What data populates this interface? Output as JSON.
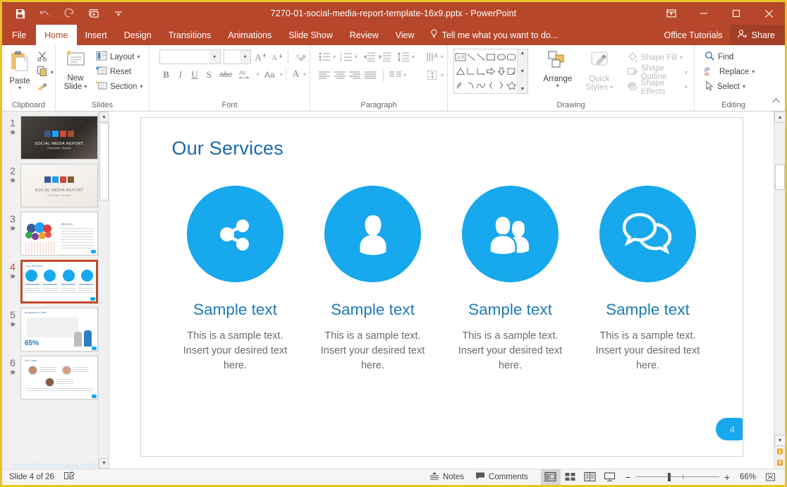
{
  "window": {
    "title": "7270-01-social-media-report-template-16x9.pptx - PowerPoint",
    "quick_access": [
      {
        "name": "save-icon",
        "label": "Save"
      },
      {
        "name": "undo-icon",
        "label": "Undo"
      },
      {
        "name": "redo-icon",
        "label": "Redo"
      },
      {
        "name": "start-presentation-icon",
        "label": "Start From Beginning"
      },
      {
        "name": "customize-qat-icon",
        "label": "Customize Quick Access Toolbar"
      }
    ],
    "controls": {
      "ribbon_display": "Ribbon Display Options",
      "minimize": "Minimize",
      "restore": "Restore Down",
      "close": "Close"
    }
  },
  "tabs": {
    "items": [
      {
        "label": "File",
        "active": false
      },
      {
        "label": "Home",
        "active": true
      },
      {
        "label": "Insert",
        "active": false
      },
      {
        "label": "Design",
        "active": false
      },
      {
        "label": "Transitions",
        "active": false
      },
      {
        "label": "Animations",
        "active": false
      },
      {
        "label": "Slide Show",
        "active": false
      },
      {
        "label": "Review",
        "active": false
      },
      {
        "label": "View",
        "active": false
      }
    ],
    "tell_me": "Tell me what you want to do...",
    "office_tutorials": "Office Tutorials",
    "share": "Share"
  },
  "ribbon": {
    "clipboard": {
      "label": "Clipboard",
      "paste": "Paste",
      "cut": "Cut",
      "copy": "Copy",
      "format_painter": "Format Painter"
    },
    "slides": {
      "label": "Slides",
      "new_slide_line1": "New",
      "new_slide_line2": "Slide",
      "layout": "Layout",
      "reset": "Reset",
      "section": "Section"
    },
    "font": {
      "label": "Font",
      "font_name_value": "",
      "font_size_value": "",
      "grow_font": "Increase Font Size",
      "shrink_font": "Decrease Font Size",
      "clear_formatting": "Clear All Formatting",
      "bold": "B",
      "italic": "I",
      "underline": "U",
      "shadow": "S",
      "strikethrough": "abc",
      "character_spacing": "AV",
      "change_case": "Aa",
      "font_color": "A"
    },
    "paragraph": {
      "label": "Paragraph",
      "bullets": "Bullets",
      "numbering": "Numbering",
      "decrease_indent": "Decrease List Level",
      "increase_indent": "Increase List Level",
      "line_spacing": "Line Spacing",
      "text_direction": "Text Direction",
      "align_text": "Align Text",
      "convert_smartart": "Convert to SmartArt",
      "align_left": "Align Left",
      "align_center": "Center",
      "align_right": "Align Right",
      "justify": "Justify",
      "columns": "Columns"
    },
    "drawing": {
      "label": "Drawing",
      "arrange": "Arrange",
      "quick_styles_line1": "Quick",
      "quick_styles_line2": "Styles",
      "shape_fill": "Shape Fill",
      "shape_outline": "Shape Outline",
      "shape_effects": "Shape Effects"
    },
    "editing": {
      "label": "Editing",
      "find": "Find",
      "replace": "Replace",
      "select": "Select"
    },
    "collapse_ribbon": "Collapse the Ribbon"
  },
  "thumbnails": [
    {
      "number": "1",
      "starred": true,
      "selected": false,
      "kind": "cover-dark"
    },
    {
      "number": "2",
      "starred": true,
      "selected": false,
      "kind": "cover-light"
    },
    {
      "number": "3",
      "starred": true,
      "selected": false,
      "kind": "about-us"
    },
    {
      "number": "4",
      "starred": true,
      "selected": true,
      "kind": "our-services"
    },
    {
      "number": "5",
      "starred": true,
      "selected": false,
      "kind": "infographic-65"
    },
    {
      "number": "6",
      "starred": true,
      "selected": false,
      "kind": "our-team"
    }
  ],
  "thumbnail_text": {
    "slide1_title": "SOCIAL MEDIA REPORT",
    "slide1_sub": "Presentation Template",
    "slide2_title": "SOCIAL MEDIA REPORT",
    "slide2_sub": "Presentation Template",
    "slide3_title": "About Us",
    "slide4_title": "Our Services",
    "slide5_title": "Infographic Chart",
    "slide5_stat": "65%",
    "slide6_title": "Our Team",
    "watermark": "www.freetemplates-college.com"
  },
  "slide": {
    "title": "Our Services",
    "page_badge": "4",
    "services": [
      {
        "icon": "share-icon",
        "heading": "Sample text",
        "body": "This is a sample text. Insert your desired text here."
      },
      {
        "icon": "user-icon",
        "heading": "Sample text",
        "body": "This is a sample text. Insert your desired text here."
      },
      {
        "icon": "users-group-icon",
        "heading": "Sample text",
        "body": "This is a sample text. Insert your desired text here."
      },
      {
        "icon": "chat-bubbles-icon",
        "heading": "Sample text",
        "body": "This is a sample text. Insert your desired text here."
      }
    ]
  },
  "status": {
    "slide_counter": "Slide 4 of 26",
    "accessibility": "Accessibility Checker",
    "notes": "Notes",
    "comments": "Comments",
    "views": [
      {
        "name": "normal-view-button",
        "label": "Normal",
        "active": true
      },
      {
        "name": "slide-sorter-button",
        "label": "Slide Sorter",
        "active": false
      },
      {
        "name": "reading-view-button",
        "label": "Reading View",
        "active": false
      },
      {
        "name": "slide-show-button",
        "label": "Slide Show",
        "active": false
      }
    ],
    "zoom_out": "−",
    "zoom_in": "+",
    "zoom_level": "66%",
    "fit_slide": "Fit slide to current window"
  },
  "colors": {
    "title_bar": "#b7472a",
    "window_border": "#e8c32b",
    "accent_blue": "#17a8ed",
    "heading_blue": "#1f7ab8",
    "selection_red": "#c0492b"
  }
}
